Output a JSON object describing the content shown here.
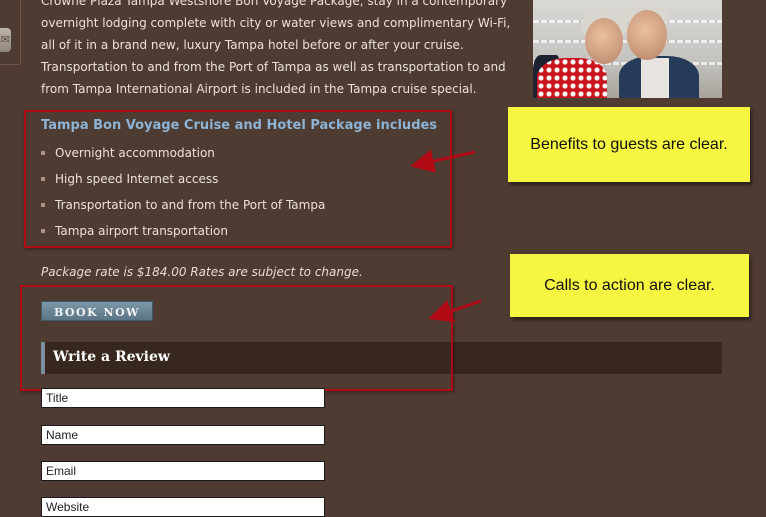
{
  "intro": {
    "text": "Crowne Plaza Tampa Westshore Bon Voyage Package, stay in a contemporary overnight lodging complete with city or water views and complimentary Wi-Fi, all of it in a brand new, luxury Tampa hotel before or after your cruise. Transportation to and from the Port of Tampa as well as transportation to and from Tampa International Airport is included in the Tampa cruise special."
  },
  "package": {
    "heading": "Tampa Bon Voyage Cruise and Hotel Package includes",
    "items": [
      "Overnight accommodation",
      "High speed Internet access",
      "Transportation to and from the Port of Tampa",
      "Tampa airport transportation"
    ],
    "rate_text": "Package rate is $184.00 Rates are subject to change."
  },
  "actions": {
    "book_now": "BOOK NOW"
  },
  "review": {
    "title": "Write a Review",
    "fields": {
      "title": "Title",
      "name": "Name",
      "email": "Email",
      "website": "Website"
    }
  },
  "annotations": {
    "benefits": "Benefits to guests are clear.",
    "cta": "Calls to action are clear."
  },
  "colors": {
    "background": "#4e3b31",
    "heading": "#8db3d6",
    "callout": "#f6f542",
    "highlight_border": "#b00b14"
  },
  "icons": {
    "share": "share-icon"
  }
}
